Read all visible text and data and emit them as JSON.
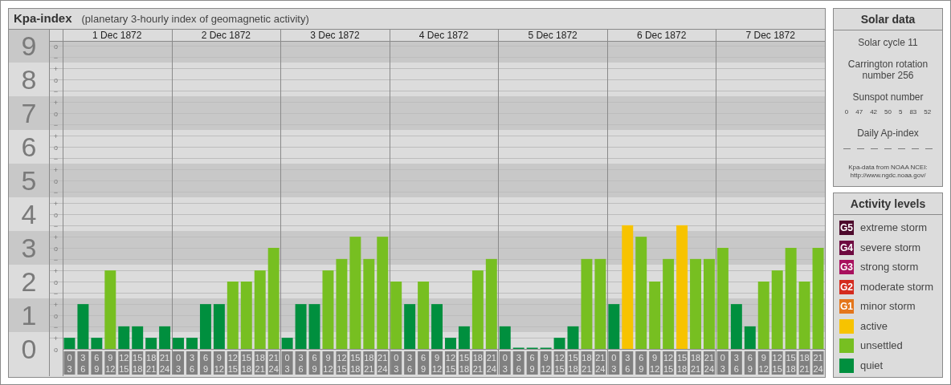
{
  "chart_panel": {
    "title": "Kpa-index",
    "subtitle": "(planetary 3-hourly index of geomagnetic activity)",
    "days": [
      "1 Dec 1872",
      "2 Dec 1872",
      "3 Dec 1872",
      "4 Dec 1872",
      "5 Dec 1872",
      "6 Dec 1872",
      "7 Dec 1872"
    ],
    "y_minor_marks": [
      "o",
      "−",
      "+",
      "o",
      "−",
      "+",
      "o",
      "−",
      "+",
      "o",
      "−",
      "+",
      "o",
      "−",
      "+",
      "o",
      "−",
      "+",
      "o",
      "−",
      "+",
      "o",
      "−",
      "+",
      "o",
      "−",
      "+",
      "o"
    ],
    "chart_data": {
      "type": "bar",
      "grid": true,
      "ylim": [
        0,
        9
      ],
      "yticks": [
        0,
        1,
        2,
        3,
        4,
        5,
        6,
        7,
        8,
        9
      ],
      "categories": [
        "0\n3",
        "3\n6",
        "6\n9",
        "9\n12",
        "12\n15",
        "15\n18",
        "18\n21",
        "21\n24",
        "0\n3",
        "3\n6",
        "6\n9",
        "9\n12",
        "12\n15",
        "15\n18",
        "18\n21",
        "21\n24",
        "0\n3",
        "3\n6",
        "6\n9",
        "9\n12",
        "12\n15",
        "15\n18",
        "18\n21",
        "21\n24",
        "0\n3",
        "3\n6",
        "6\n9",
        "9\n12",
        "12\n15",
        "15\n18",
        "18\n21",
        "21\n24",
        "0\n3",
        "3\n6",
        "6\n9",
        "9\n12",
        "12\n15",
        "15\n18",
        "18\n21",
        "21\n24",
        "0\n3",
        "3\n6",
        "6\n9",
        "9\n12",
        "12\n15",
        "15\n18",
        "18\n21",
        "21\n24",
        "0\n3",
        "3\n6",
        "6\n9",
        "9\n12",
        "12\n15",
        "15\n18",
        "18\n21",
        "21\n24"
      ],
      "series": [
        {
          "name": "quiet",
          "color": "#008f3e",
          "values": [
            0.33,
            1.33,
            0.33,
            null,
            0.67,
            0.67,
            0.33,
            0.67,
            0.33,
            0.33,
            1.33,
            1.33,
            null,
            null,
            null,
            null,
            0.33,
            1.33,
            1.33,
            null,
            null,
            null,
            null,
            null,
            null,
            1.33,
            null,
            1.33,
            0.33,
            0.67,
            null,
            null,
            0.67,
            0,
            0,
            0,
            0.33,
            0.67,
            null,
            null,
            1.33,
            null,
            null,
            null,
            null,
            null,
            null,
            null,
            null,
            1.33,
            0.67,
            null,
            null,
            null,
            null,
            null
          ]
        },
        {
          "name": "unsettled",
          "color": "#77bf21",
          "values": [
            null,
            null,
            null,
            2.33,
            null,
            null,
            null,
            null,
            null,
            null,
            null,
            null,
            2,
            2,
            2.33,
            3,
            null,
            null,
            null,
            2.33,
            2.67,
            3.33,
            2.67,
            3.33,
            2,
            null,
            2,
            null,
            null,
            null,
            2.33,
            2.67,
            null,
            null,
            null,
            null,
            null,
            null,
            2.67,
            2.67,
            null,
            null,
            3.33,
            2,
            2.67,
            null,
            2.67,
            2.67,
            3,
            null,
            null,
            2,
            2.33,
            3,
            2,
            3
          ]
        },
        {
          "name": "active",
          "color": "#f7c300",
          "values": [
            null,
            null,
            null,
            null,
            null,
            null,
            null,
            null,
            null,
            null,
            null,
            null,
            null,
            null,
            null,
            null,
            null,
            null,
            null,
            null,
            null,
            null,
            null,
            null,
            null,
            null,
            null,
            null,
            null,
            null,
            null,
            null,
            null,
            null,
            null,
            null,
            null,
            null,
            null,
            null,
            null,
            3.67,
            null,
            null,
            null,
            3.67,
            null,
            null,
            null,
            null,
            null,
            null,
            null,
            null,
            null,
            null
          ]
        }
      ]
    }
  },
  "solar_data": {
    "title": "Solar data",
    "solar_cycle": "Solar cycle 11",
    "carrington_rotation": "Carrington rotation number 256",
    "sunspot_heading": "Sunspot number",
    "sunspot_numbers": [
      "0",
      "47",
      "42",
      "50",
      "5",
      "83",
      "52"
    ],
    "ap_heading": "Daily Ap-index",
    "ap_values": [
      "—",
      "—",
      "—",
      "—",
      "—",
      "—",
      "—"
    ],
    "source_text": "Kpa-data from NOAA NCEI:",
    "source_link": "http://www.ngdc.noaa.gov/"
  },
  "activity_levels": {
    "title": "Activity levels",
    "items": [
      {
        "badge": "G5",
        "label": "extreme storm",
        "color": "#4d0a2c"
      },
      {
        "badge": "G4",
        "label": "severe storm",
        "color": "#6e0a40"
      },
      {
        "badge": "G3",
        "label": "strong storm",
        "color": "#a8105e"
      },
      {
        "badge": "G2",
        "label": "moderate storm",
        "color": "#d42a1e"
      },
      {
        "badge": "G1",
        "label": "minor storm",
        "color": "#e4761c"
      }
    ]
  }
}
